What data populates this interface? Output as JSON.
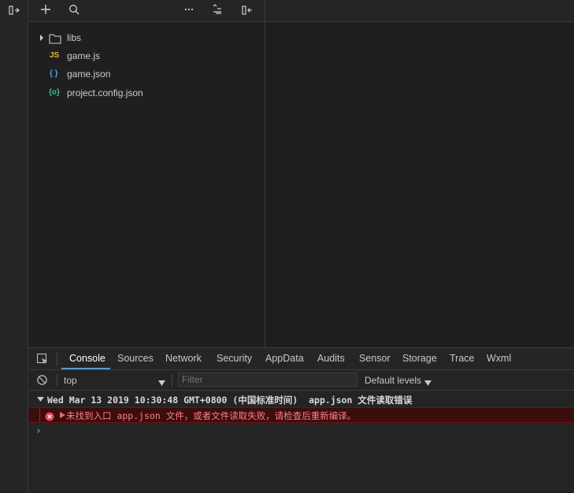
{
  "toolbar": {
    "icons": [
      "panel-toggle-icon",
      "plus-icon",
      "search-icon",
      "more-icon",
      "collapse-icon",
      "panel-back-icon"
    ]
  },
  "file_tree": [
    {
      "name": "libs",
      "type": "folder",
      "icon": "folder-icon",
      "collapsed": true
    },
    {
      "name": "game.js",
      "type": "file",
      "icon": "js-icon",
      "badge": "JS",
      "color": "#e8b53a"
    },
    {
      "name": "game.json",
      "type": "file",
      "icon": "json-icon",
      "badge": "{ }",
      "color": "#4aa8e0"
    },
    {
      "name": "project.config.json",
      "type": "file",
      "icon": "config-icon",
      "badge": "{o}",
      "color": "#3fbf8f"
    }
  ],
  "devtools": {
    "tabs": [
      "Console",
      "Sources",
      "Network",
      "Security",
      "AppData",
      "Audits",
      "Sensor",
      "Storage",
      "Trace",
      "Wxml"
    ],
    "active_tab": "Console",
    "context_select": "top",
    "filter_placeholder": "Filter",
    "levels_label": "Default levels",
    "console": {
      "group_header": "Wed Mar 13 2019 10:30:48 GMT+0800 (中国标准时间)  app.json 文件读取错误",
      "error_message": "未找到入口 app.json 文件，或者文件读取失败，请检查后重新编译。",
      "prompt": "›"
    }
  },
  "colors": {
    "accent": "#5b9bd5",
    "error_bg": "#3b0d0d",
    "error_text": "#ff8080",
    "error_border": "#6a1414"
  }
}
